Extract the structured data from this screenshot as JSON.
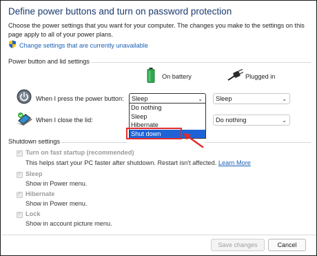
{
  "header": {
    "title": "Define power buttons and turn on password protection",
    "description": "Choose the power settings that you want for your computer. The changes you make to the settings on this page apply to all of your power plans.",
    "change_link": "Change settings that are currently unavailable"
  },
  "power_section": {
    "label": "Power button and lid settings",
    "on_battery": "On battery",
    "plugged_in": "Plugged in",
    "rows": [
      {
        "label": "When I press the power button:",
        "battery_value": "Sleep",
        "plugged_value": "Sleep"
      },
      {
        "label": "When I close the lid:",
        "plugged_value": "Do nothing"
      }
    ],
    "dropdown_options": [
      "Do nothing",
      "Sleep",
      "Hibernate",
      "Shut down"
    ],
    "selected_option": "Shut down"
  },
  "shutdown_section": {
    "label": "Shutdown settings",
    "items": [
      {
        "label": "Turn on fast startup (recommended)",
        "desc_before_link": "This helps start your PC faster after shutdown. Restart isn't affected. ",
        "link": "Learn More"
      },
      {
        "label": "Sleep",
        "desc": "Show in Power menu."
      },
      {
        "label": "Hibernate",
        "desc": "Show in Power menu."
      },
      {
        "label": "Lock",
        "desc": "Show in account picture menu."
      }
    ]
  },
  "footer": {
    "save_label": "Save changes",
    "cancel_label": "Cancel"
  },
  "colors": {
    "title": "#1a3a6e",
    "link": "#1a5fb4",
    "selection": "#1e63d6",
    "callout": "#e02b2b"
  }
}
